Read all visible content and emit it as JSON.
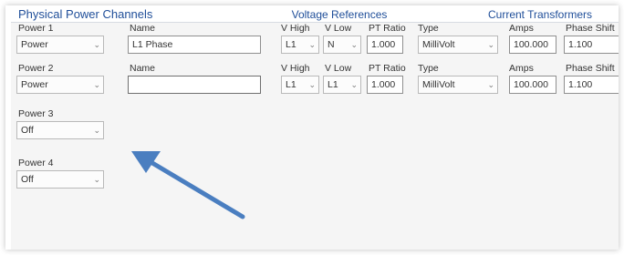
{
  "panel": {
    "title": "Physical Power Channels"
  },
  "sections": {
    "voltage": "Voltage References",
    "current": "Current Transformers"
  },
  "labels": {
    "name": "Name",
    "v_high": "V High",
    "v_low": "V Low",
    "pt_ratio": "PT Ratio",
    "type": "Type",
    "amps": "Amps",
    "phase_shift": "Phase Shift"
  },
  "channels": [
    {
      "label": "Power 1",
      "mode": "Power",
      "name": "L1 Phase",
      "v_high": "L1",
      "v_low": "N",
      "pt_ratio": "1.000",
      "ct_type": "MilliVolt",
      "amps": "100.000",
      "phase_shift": "1.100"
    },
    {
      "label": "Power 2",
      "mode": "Power",
      "name": "",
      "v_high": "L1",
      "v_low": "L1",
      "pt_ratio": "1.000",
      "ct_type": "MilliVolt",
      "amps": "100.000",
      "phase_shift": "1.100"
    },
    {
      "label": "Power 3",
      "mode": "Off"
    },
    {
      "label": "Power 4",
      "mode": "Off"
    }
  ],
  "caret_glyph": "⌄",
  "colors": {
    "title": "#1f4e99",
    "arrow": "#4a7ec0"
  }
}
